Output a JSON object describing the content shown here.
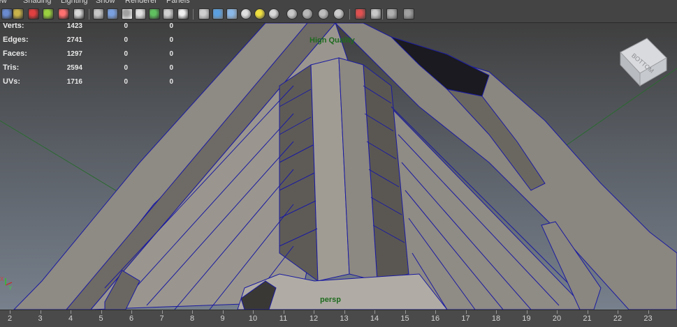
{
  "menu": [
    "View",
    "Shading",
    "Lighting",
    "Show",
    "Renderer",
    "Panels"
  ],
  "toolbar": {
    "icons": [
      "select-camera-icon",
      "camera-attributes-icon",
      "bookmark-icon",
      "image-plane-icon",
      "grease-pencil-icon",
      "2d-pan-zoom-icon",
      "grid-icon",
      "film-gate-icon",
      "resolution-gate-icon",
      "gate-mask-icon",
      "field-chart-icon",
      "safe-action-icon",
      "safe-title-icon",
      "wireframe-icon",
      "smooth-shade-icon",
      "wireframe-on-shaded-icon",
      "textured-icon",
      "use-all-lights-icon",
      "shadows-icon",
      "screen-space-ao-icon",
      "motion-blur-icon",
      "multisample-aa-icon",
      "depth-of-field-icon",
      "isolate-select-icon",
      "xray-icon",
      "xray-joints-icon",
      "xray-components-icon"
    ]
  },
  "hud": {
    "stats": [
      {
        "label": "Verts:",
        "v1": "1423",
        "v2": "0",
        "v3": "0"
      },
      {
        "label": "Edges:",
        "v1": "2741",
        "v2": "0",
        "v3": "0"
      },
      {
        "label": "Faces:",
        "v1": "1297",
        "v2": "0",
        "v3": "0"
      },
      {
        "label": "Tris:",
        "v1": "2594",
        "v2": "0",
        "v3": "0"
      },
      {
        "label": "UVs:",
        "v1": "1716",
        "v2": "0",
        "v3": "0"
      }
    ],
    "quality": "High Quality",
    "camera": "persp",
    "viewcube_face": "BOTTOM",
    "axis_x": "X",
    "axis_y": "Y"
  },
  "timeline": {
    "frames": [
      "2",
      "3",
      "4",
      "5",
      "6",
      "7",
      "8",
      "9",
      "10",
      "11",
      "12",
      "13",
      "14",
      "15",
      "16",
      "17",
      "18",
      "19",
      "20",
      "21",
      "22",
      "23"
    ]
  }
}
